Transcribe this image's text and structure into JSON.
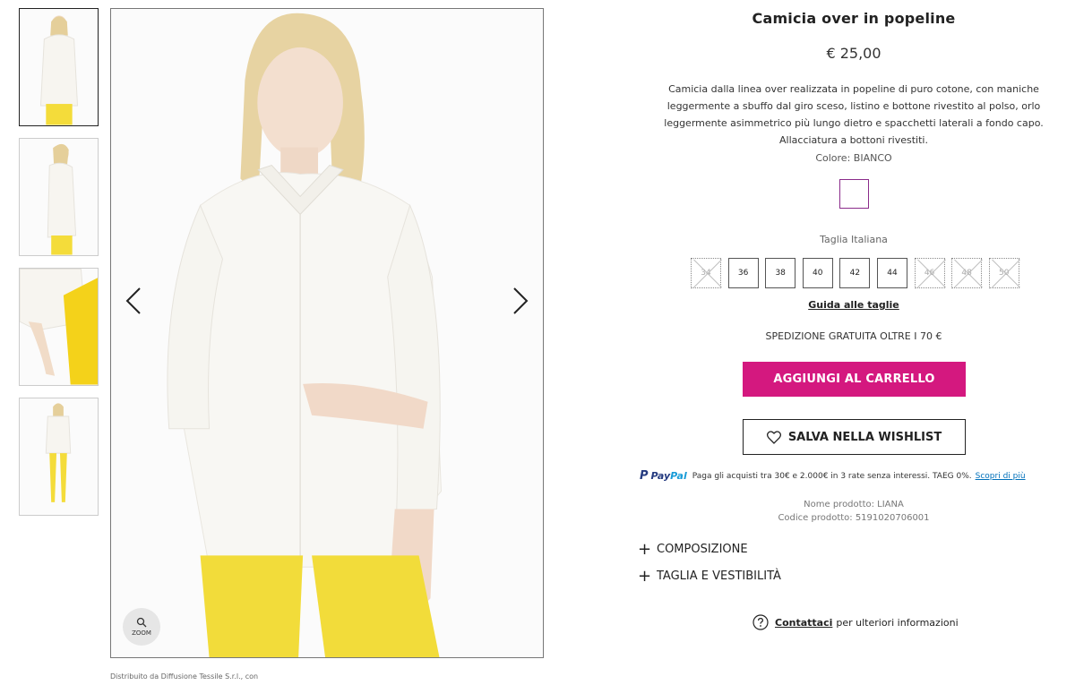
{
  "gallery": {
    "thumbnails": [
      {
        "alt": "front-view"
      },
      {
        "alt": "side-view"
      },
      {
        "alt": "detail-view"
      },
      {
        "alt": "full-body-view"
      }
    ],
    "zoom_label": "ZOOM",
    "footnote": "Distribuito da Diffusione Tessile S.r.l., con"
  },
  "product": {
    "title": "Camicia over in popeline",
    "price": "€ 25,00",
    "description": "Camicia dalla linea over realizzata in popeline di puro cotone, con maniche leggermente a sbuffo dal giro sceso, listino e bottone rivestito al polso, orlo leggermente asimmetrico più lungo dietro e spacchetti laterali a fondo capo. Allacciatura a bottoni rivestiti.",
    "color_label": "Colore: BIANCO",
    "swatch_color": "#ffffff",
    "size_label": "Taglia Italiana",
    "sizes": [
      {
        "label": "34",
        "available": false
      },
      {
        "label": "36",
        "available": true
      },
      {
        "label": "38",
        "available": true
      },
      {
        "label": "40",
        "available": true
      },
      {
        "label": "42",
        "available": true
      },
      {
        "label": "44",
        "available": true
      },
      {
        "label": "46",
        "available": false
      },
      {
        "label": "48",
        "available": false
      },
      {
        "label": "50",
        "available": false
      }
    ],
    "size_guide": "Guida alle taglie",
    "shipping": "SPEDIZIONE GRATUITA OLTRE I 70 €",
    "add_to_cart": "AGGIUNGI AL CARRELLO",
    "wishlist": "SALVA NELLA WISHLIST",
    "paypal": {
      "logo_p": "P",
      "logo_pay": "Pay",
      "logo_pal": "Pal",
      "text": "Paga gli acquisti tra 30€ e 2.000€ in 3 rate senza interessi. TAEG 0%.",
      "link": "Scopri di più"
    },
    "product_name": "Nome prodotto: LIANA",
    "product_code": "Codice prodotto:  5191020706001",
    "accordions": [
      "COMPOSIZIONE",
      "TAGLIA E VESTIBILITÀ"
    ],
    "contact_link": "Contattaci",
    "contact_text": "per ulteriori informazioni"
  },
  "colors": {
    "accent": "#d4187f",
    "swatch_border": "#8a2b8a",
    "paypal_blue": "#253b80",
    "paypal_light": "#179bd7"
  }
}
